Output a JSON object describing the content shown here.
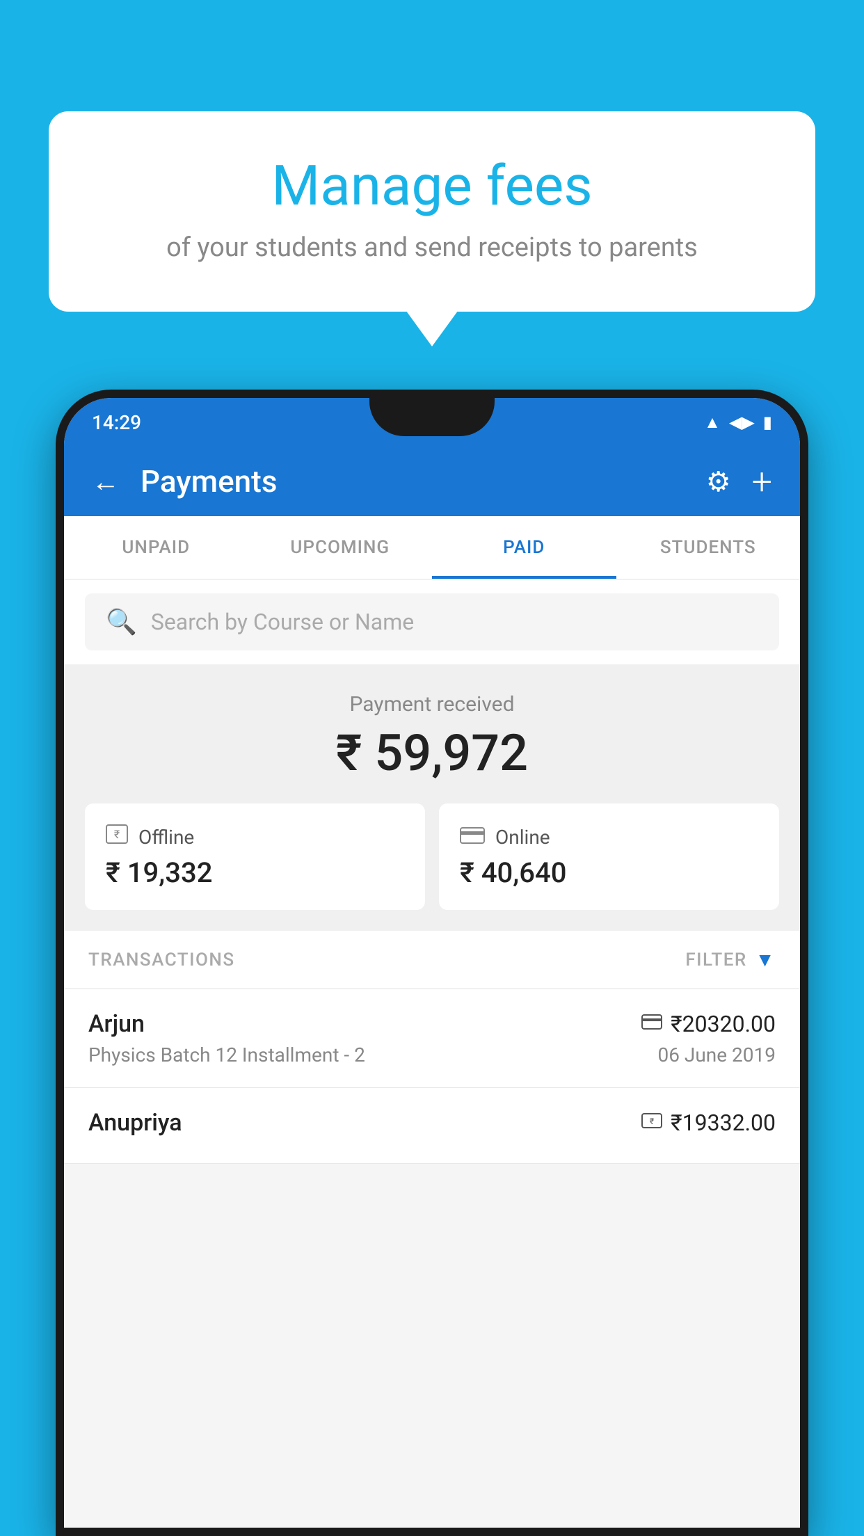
{
  "background_color": "#1ab3e8",
  "speech_bubble": {
    "title": "Manage fees",
    "subtitle": "of your students and send receipts to parents"
  },
  "status_bar": {
    "time": "14:29",
    "wifi_icon": "wifi",
    "signal_icon": "signal",
    "battery_icon": "battery"
  },
  "app_bar": {
    "title": "Payments",
    "back_label": "←",
    "settings_icon": "gear",
    "add_icon": "+"
  },
  "tabs": [
    {
      "label": "UNPAID",
      "active": false
    },
    {
      "label": "UPCOMING",
      "active": false
    },
    {
      "label": "PAID",
      "active": true
    },
    {
      "label": "STUDENTS",
      "active": false
    }
  ],
  "search": {
    "placeholder": "Search by Course or Name"
  },
  "payment_received": {
    "label": "Payment received",
    "amount": "₹ 59,972"
  },
  "payment_cards": [
    {
      "icon": "💳",
      "label": "Offline",
      "amount": "₹ 19,332"
    },
    {
      "icon": "💳",
      "label": "Online",
      "amount": "₹ 40,640"
    }
  ],
  "transactions_section": {
    "label": "TRANSACTIONS",
    "filter_label": "FILTER"
  },
  "transactions": [
    {
      "name": "Arjun",
      "course": "Physics Batch 12 Installment - 2",
      "amount": "₹20320.00",
      "date": "06 June 2019",
      "mode_icon": "💳"
    },
    {
      "name": "Anupriya",
      "course": "",
      "amount": "₹19332.00",
      "date": "",
      "mode_icon": "💵"
    }
  ]
}
